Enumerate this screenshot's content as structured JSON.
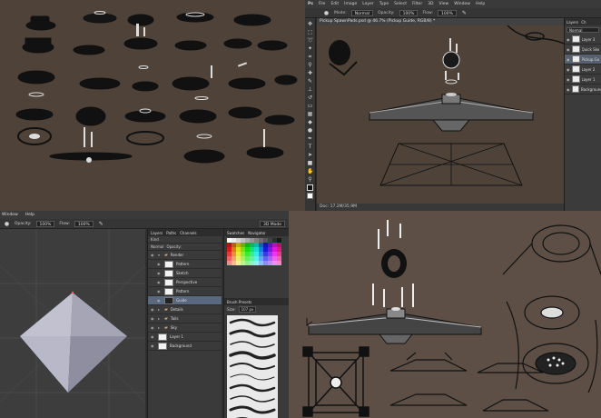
{
  "photoshop": {
    "logo": "Ps",
    "menu": [
      "File",
      "Edit",
      "Image",
      "Layer",
      "Type",
      "Select",
      "Filter",
      "3D",
      "View",
      "Window",
      "Help"
    ],
    "options": {
      "mode_label": "Mode:",
      "mode_value": "Normal",
      "opacity_label": "Opacity:",
      "opacity_value": "100%",
      "flow_label": "Flow:",
      "flow_value": "100%"
    },
    "tools": [
      "move-tool",
      "marquee-tool",
      "lasso-tool",
      "quick-select-tool",
      "crop-tool",
      "eyedropper-tool",
      "healing-tool",
      "brush-tool",
      "stamp-tool",
      "history-brush-tool",
      "eraser-tool",
      "gradient-tool",
      "blur-tool",
      "dodge-tool",
      "pen-tool",
      "type-tool",
      "path-select-tool",
      "shape-tool",
      "hand-tool",
      "zoom-tool"
    ],
    "document_tab": "Pickup SpawnPads.psd @ 46.7% (Pickup Guide, RGB/8) *",
    "status": "Doc: 17.2M/35.9M",
    "layers_panel": {
      "tabs": [
        "Layers",
        "Ch"
      ],
      "blend": "Normal",
      "layers": [
        {
          "name": "Layer 3",
          "selected": false
        },
        {
          "name": "Quick Ske",
          "selected": false
        },
        {
          "name": "Pickup Gu",
          "selected": true
        },
        {
          "name": "Layer 2",
          "selected": false
        },
        {
          "name": "Layer 1",
          "selected": false
        },
        {
          "name": "Background",
          "selected": false
        }
      ]
    }
  },
  "app3d": {
    "menu": [
      "Window",
      "Help"
    ],
    "options": {
      "opacity_label": "Opacity:",
      "opacity_value": "100%",
      "flow_label": "Flow:",
      "flow_value": "100%",
      "workspace": "3D Mode"
    },
    "layers_panel": {
      "tabs": [
        "Layers",
        "Paths",
        "Channels"
      ],
      "kind_label": "Kind",
      "blend": "Normal",
      "opacity_label": "Opacity:",
      "rows": [
        {
          "name": "Render",
          "type": "folder",
          "indent": 0,
          "selected": false
        },
        {
          "name": "Pattern",
          "type": "layer",
          "indent": 1,
          "selected": false
        },
        {
          "name": "Sketch",
          "type": "layer",
          "indent": 1,
          "selected": false
        },
        {
          "name": "Perspective",
          "type": "layer",
          "indent": 1,
          "selected": false
        },
        {
          "name": "Pattern",
          "type": "layer",
          "indent": 1,
          "selected": false
        },
        {
          "name": "Guide",
          "type": "layer",
          "indent": 1,
          "selected": true
        },
        {
          "name": "Details",
          "type": "folder",
          "indent": 0,
          "selected": false
        },
        {
          "name": "Tails",
          "type": "folder",
          "indent": 0,
          "selected": false
        },
        {
          "name": "Sky",
          "type": "folder",
          "indent": 0,
          "selected": false
        },
        {
          "name": "Layer 1",
          "type": "layer",
          "indent": 0,
          "selected": false
        },
        {
          "name": "Background",
          "type": "layer",
          "indent": 0,
          "selected": false
        }
      ]
    },
    "swatches_panel": {
      "tabs": [
        "Swatches",
        "Navigator"
      ]
    },
    "brush_presets": {
      "title": "Brush Presets",
      "size_label": "Size:",
      "size_value": "107 px"
    }
  }
}
